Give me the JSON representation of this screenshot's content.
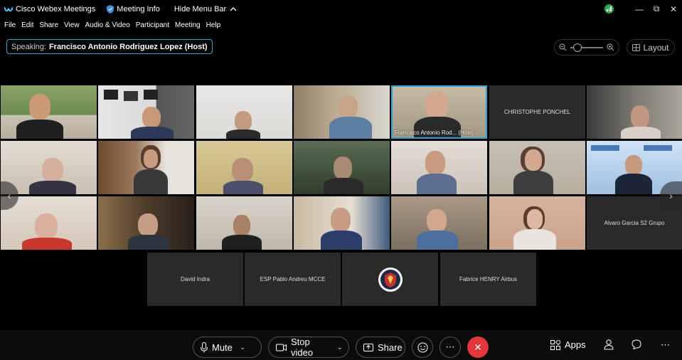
{
  "titlebar": {
    "app_title": "Cisco Webex Meetings",
    "meeting_info": "Meeting Info",
    "hide_menu": "Hide Menu Bar"
  },
  "menu": [
    "File",
    "Edit",
    "Share",
    "View",
    "Audio & Video",
    "Participant",
    "Meeting",
    "Help"
  ],
  "speaking": {
    "label": "Speaking:",
    "name": "Francisco Antonio Rodriguez Lopez (Host)"
  },
  "layout_label": "Layout",
  "tiles": {
    "active_tag": "Francisco Antonio Rod...  (Host)",
    "christophe": "CHRISTOPHE PONCHEL",
    "alvaro": "Alvaro Garcia S2 Grupo",
    "david": "David Indra",
    "pablo": "ESP Pablo Andreu MCCE",
    "fabrice": "Fabrice HENRY Airbus"
  },
  "controls": {
    "mute": "Mute",
    "stop_video": "Stop video",
    "share": "Share",
    "apps": "Apps"
  },
  "colors": {
    "accent": "#28a4d8",
    "leave": "#e5373a",
    "network": "#2fa44f"
  }
}
